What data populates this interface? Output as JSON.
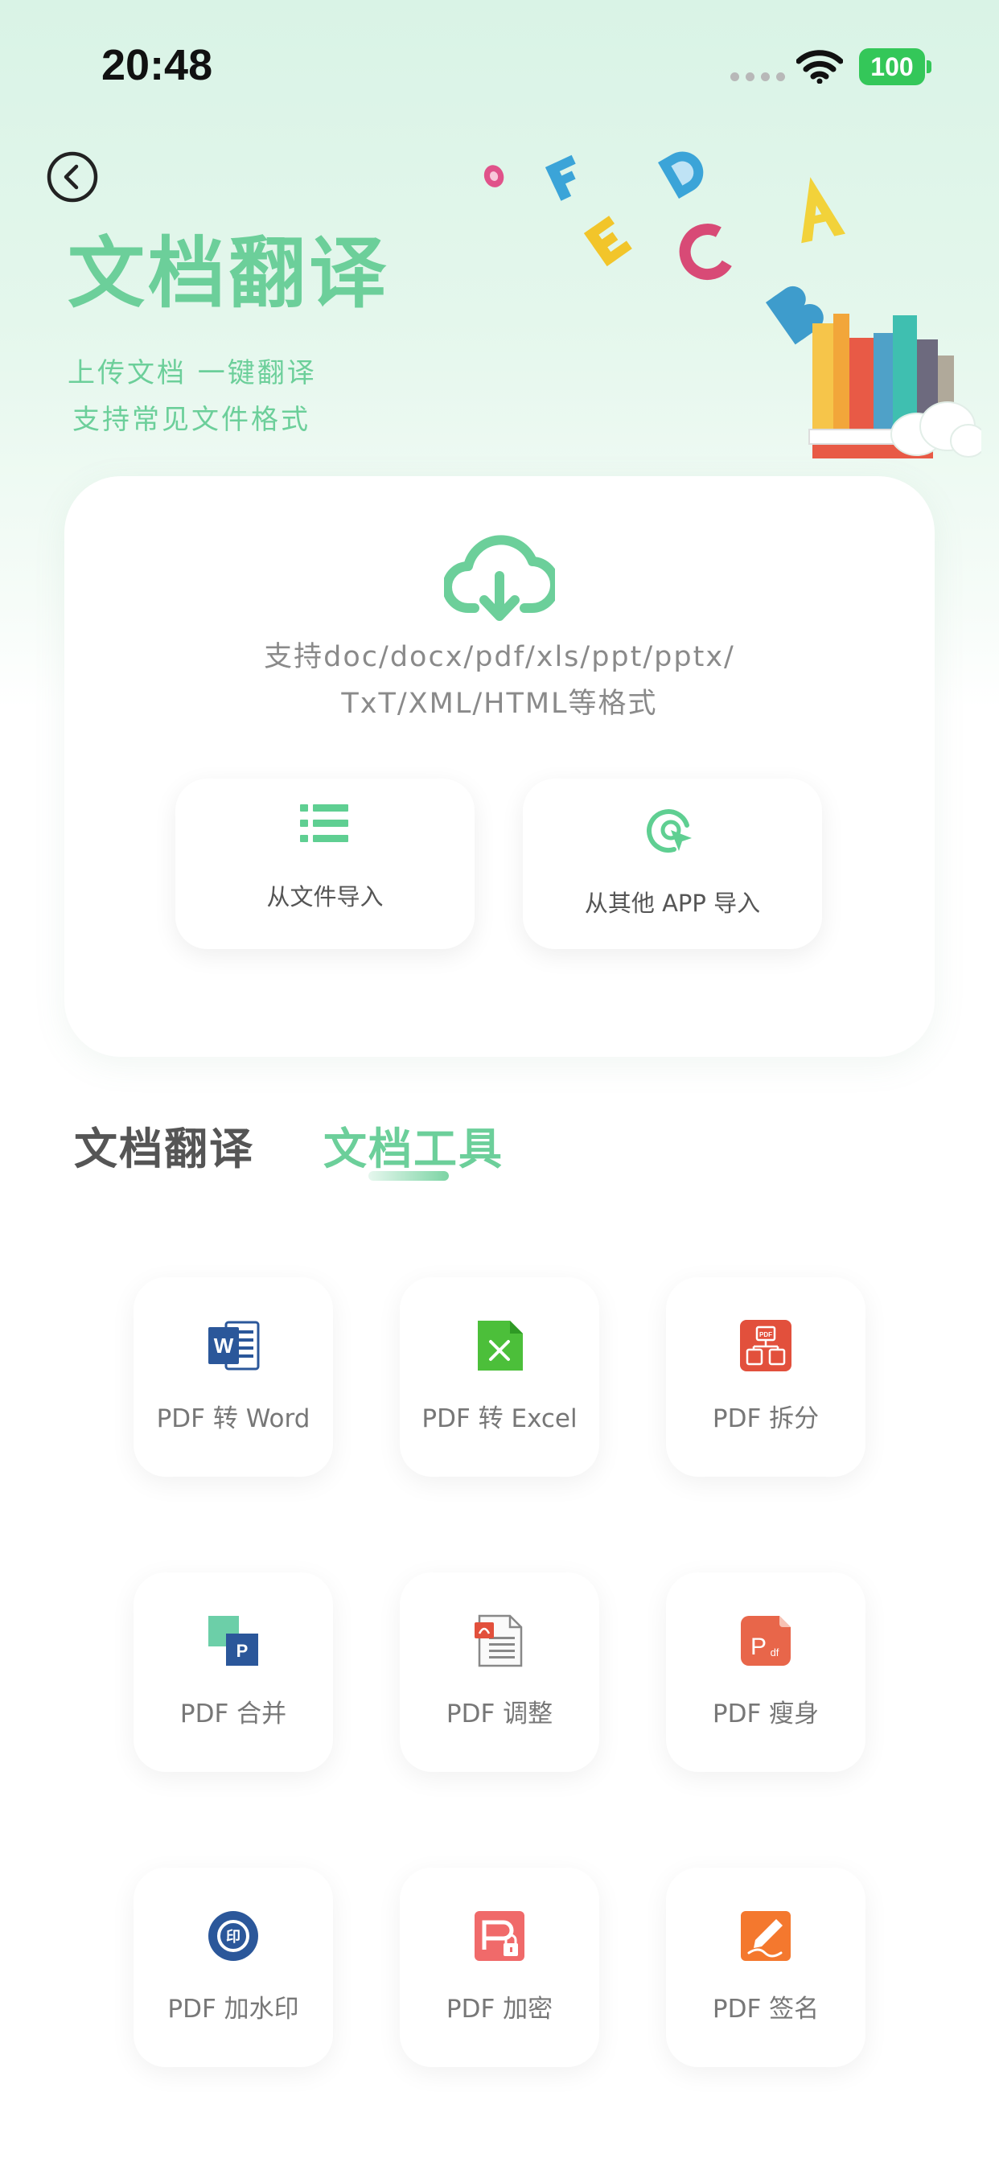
{
  "status_bar": {
    "time": "20:48",
    "battery": "100"
  },
  "header": {
    "title": "文档翻译",
    "subtitle_1": "上传文档 一键翻译",
    "subtitle_2": "支持常见文件格式"
  },
  "upload": {
    "support_line_1": "支持doc/docx/pdf/xls/ppt/pptx/",
    "support_line_2": "TxT/XML/HTML等格式",
    "import_file_label": "从文件导入",
    "import_app_label": "从其他 APP 导入"
  },
  "tabs": [
    {
      "label": "文档翻译",
      "active": false
    },
    {
      "label": "文档工具",
      "active": true
    }
  ],
  "tools": [
    {
      "label": "PDF 转 Word",
      "icon": "word-icon"
    },
    {
      "label": "PDF 转 Excel",
      "icon": "excel-icon"
    },
    {
      "label": "PDF 拆分",
      "icon": "pdf-split-icon"
    },
    {
      "label": "PDF 合并",
      "icon": "pdf-merge-icon"
    },
    {
      "label": "PDF 调整",
      "icon": "pdf-adjust-icon"
    },
    {
      "label": "PDF 瘦身",
      "icon": "pdf-compress-icon"
    },
    {
      "label": "PDF 加水印",
      "icon": "watermark-icon"
    },
    {
      "label": "PDF 加密",
      "icon": "pdf-lock-icon"
    },
    {
      "label": "PDF 签名",
      "icon": "signature-icon"
    }
  ],
  "colors": {
    "accent": "#6ccf9a",
    "battery": "#34c759"
  }
}
